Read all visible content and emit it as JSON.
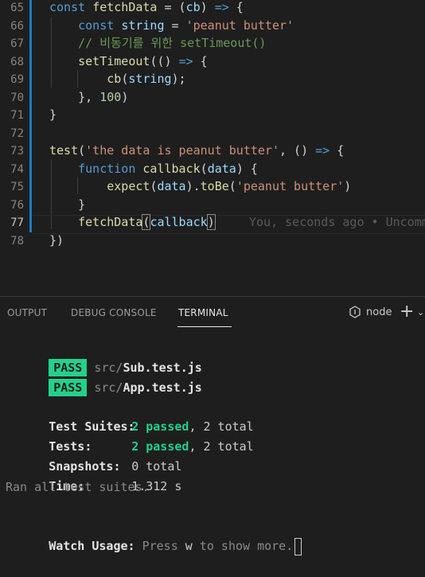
{
  "editor": {
    "lines": [
      {
        "num": "65",
        "parts": [
          {
            "t": "const ",
            "c": "kw"
          },
          {
            "t": "fetchData",
            "c": "fn"
          },
          {
            "t": " = (",
            "c": ""
          },
          {
            "t": "cb",
            "c": "var"
          },
          {
            "t": ") ",
            "c": ""
          },
          {
            "t": "=>",
            "c": "kw"
          },
          {
            "t": " {",
            "c": ""
          }
        ]
      },
      {
        "num": "66",
        "parts": [
          {
            "t": "    const ",
            "c": "kw"
          },
          {
            "t": "string",
            "c": "var"
          },
          {
            "t": " = ",
            "c": ""
          },
          {
            "t": "'peanut butter'",
            "c": "str"
          }
        ]
      },
      {
        "num": "67",
        "parts": [
          {
            "t": "    // 비동기를 위한 setTimeout()",
            "c": "cmt"
          }
        ]
      },
      {
        "num": "68",
        "parts": [
          {
            "t": "    ",
            "c": ""
          },
          {
            "t": "setTimeout",
            "c": "fn"
          },
          {
            "t": "(() ",
            "c": ""
          },
          {
            "t": "=>",
            "c": "kw"
          },
          {
            "t": " {",
            "c": ""
          }
        ]
      },
      {
        "num": "69",
        "parts": [
          {
            "t": "        ",
            "c": ""
          },
          {
            "t": "cb",
            "c": "fn"
          },
          {
            "t": "(",
            "c": ""
          },
          {
            "t": "string",
            "c": "var"
          },
          {
            "t": ");",
            "c": ""
          }
        ]
      },
      {
        "num": "70",
        "parts": [
          {
            "t": "    }, ",
            "c": ""
          },
          {
            "t": "100",
            "c": "num"
          },
          {
            "t": ")",
            "c": ""
          }
        ]
      },
      {
        "num": "71",
        "parts": [
          {
            "t": "}",
            "c": ""
          }
        ]
      },
      {
        "num": "72",
        "parts": []
      },
      {
        "num": "73",
        "parts": [
          {
            "t": "test",
            "c": "fn"
          },
          {
            "t": "(",
            "c": ""
          },
          {
            "t": "'the data is peanut butter'",
            "c": "str"
          },
          {
            "t": ", () ",
            "c": ""
          },
          {
            "t": "=>",
            "c": "kw"
          },
          {
            "t": " {",
            "c": ""
          }
        ]
      },
      {
        "num": "74",
        "parts": [
          {
            "t": "    function ",
            "c": "kw"
          },
          {
            "t": "callback",
            "c": "fn"
          },
          {
            "t": "(",
            "c": ""
          },
          {
            "t": "data",
            "c": "var"
          },
          {
            "t": ") {",
            "c": ""
          }
        ]
      },
      {
        "num": "75",
        "parts": [
          {
            "t": "        ",
            "c": ""
          },
          {
            "t": "expect",
            "c": "fn"
          },
          {
            "t": "(",
            "c": ""
          },
          {
            "t": "data",
            "c": "var"
          },
          {
            "t": ").",
            "c": ""
          },
          {
            "t": "toBe",
            "c": "fn"
          },
          {
            "t": "(",
            "c": ""
          },
          {
            "t": "'peanut butter'",
            "c": "str"
          },
          {
            "t": ")",
            "c": ""
          }
        ]
      },
      {
        "num": "76",
        "parts": [
          {
            "t": "    }",
            "c": ""
          }
        ]
      },
      {
        "num": "77",
        "current": true,
        "parts": [
          {
            "t": "    ",
            "c": ""
          },
          {
            "t": "fetchData",
            "c": "fn"
          },
          {
            "t": "(",
            "c": "hl"
          },
          {
            "t": "callback",
            "c": "var"
          },
          {
            "t": ")",
            "c": "hl"
          }
        ],
        "blame": "You, seconds ago • Uncommitted"
      },
      {
        "num": "78",
        "parts": [
          {
            "t": "})",
            "c": ""
          }
        ]
      }
    ]
  },
  "panel": {
    "tabs": {
      "output": "OUTPUT",
      "debug": "DEBUG CONSOLE",
      "terminal": "TERMINAL"
    },
    "terminal_kind": "node",
    "plus_label": "+",
    "chevron": "⌄"
  },
  "terminal": {
    "pass_label": "PASS",
    "results": [
      {
        "dir": "src/",
        "file": "Sub.test.js"
      },
      {
        "dir": "src/",
        "file": "App.test.js"
      }
    ],
    "suites_label": "Test Suites:",
    "suites_passed": "2 passed",
    "suites_total": ", 2 total",
    "tests_label": "Tests:",
    "tests_passed": "2 passed",
    "tests_total": ", 2 total",
    "snapshots_label": "Snapshots:",
    "snapshots_value": "0 total",
    "time_label": "Time:",
    "time_value": "1.312 s",
    "ran_all": "Ran all test suites.",
    "watch_label": "Watch Usage:",
    "watch_press": "Press ",
    "watch_key": "w",
    "watch_rest": " to show more."
  }
}
